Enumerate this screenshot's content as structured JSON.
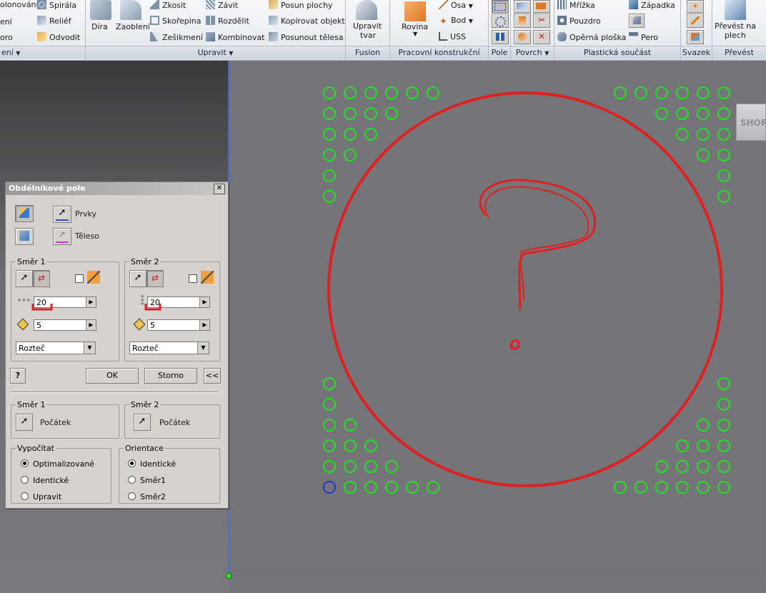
{
  "ribbon": {
    "col0": [
      "olonování",
      "ení",
      "oro"
    ],
    "col0_group": "ení",
    "col1": [
      "Spirála",
      "Reliéf",
      "Odvodit"
    ],
    "big_buttons": {
      "dira": "Díra",
      "zaobleni": "Zaoblení"
    },
    "modify_col1": [
      "Zkosit",
      "Skořepina",
      "Zešikmení"
    ],
    "modify_col2": [
      "Závit",
      "Rozdělit",
      "Kombinovat"
    ],
    "modify_col3": [
      "Posun plochy",
      "Kopírovat objekt",
      "Posunout tělesa"
    ],
    "group_modify": "Upravit",
    "fusion_button": [
      "Upravit",
      "tvar"
    ],
    "group_fusion": "Fusion",
    "plane_button": "Rovina",
    "work_col": [
      "Osa",
      "Bod",
      "USS"
    ],
    "group_work": "Pracovní konstrukční prvky",
    "group_pattern": "Pole",
    "group_surface": "Povrch",
    "plastic_col1": [
      "Mřížka",
      "Pouzdro",
      "Opěrná ploška"
    ],
    "plastic_col2": [
      "Západka",
      "",
      "Pero"
    ],
    "group_plastic": "Plastická součást",
    "group_harness": "Svazek",
    "convert_button": [
      "Převést na",
      "plech"
    ],
    "group_convert": "Převést"
  },
  "dialog": {
    "title": "Obdélníkové pole",
    "features_label": "Prvky",
    "solid_label": "Těleso",
    "dir1": {
      "label": "Směr 1",
      "count": "20",
      "spacing": "5",
      "mode": "Rozteč"
    },
    "dir2": {
      "label": "Směr 2",
      "count": "20",
      "spacing": "5",
      "mode": "Rozteč"
    },
    "ok": "OK",
    "cancel": "Storno",
    "more": "<<",
    "start1": {
      "label": "Směr 1",
      "value": "Počátek"
    },
    "start2": {
      "label": "Směr 2",
      "value": "Počátek"
    },
    "compute": {
      "label": "Vypočítat",
      "options": [
        "Optimalizované",
        "Identické",
        "Upravit"
      ],
      "selected": 0
    },
    "orientation": {
      "label": "Orientace",
      "options": [
        "Identické",
        "Směr1",
        "Směr2"
      ],
      "selected": 0
    }
  },
  "viewport": {
    "viewcube_label": "SHORA",
    "annotation": "?",
    "colors": {
      "holes": "#22e022",
      "selected_hole": "#1a3acc",
      "annotation": "#e02020",
      "axis": "#3a6cff",
      "background": "#757579"
    }
  }
}
